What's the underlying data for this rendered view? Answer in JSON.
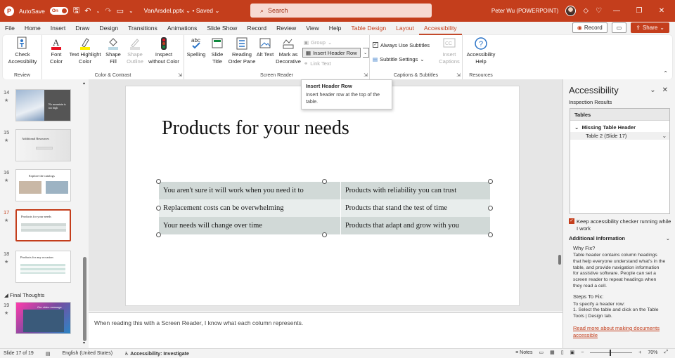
{
  "titlebar": {
    "autosave_label": "AutoSave",
    "autosave_state": "On",
    "doc_name": "VanArsdel.pptx",
    "doc_status": "• Saved",
    "search_placeholder": "Search",
    "user": "Peter Wu (POWERPOINT)"
  },
  "menu": {
    "items": [
      "File",
      "Home",
      "Insert",
      "Draw",
      "Design",
      "Transitions",
      "Animations",
      "Slide Show",
      "Record",
      "Review",
      "View",
      "Help",
      "Table Design",
      "Layout",
      "Accessibility"
    ],
    "record_btn": "Record",
    "share_btn": "Share"
  },
  "ribbon": {
    "review_group": {
      "label": "Review",
      "check_btn": "Check Accessibility"
    },
    "color_group": {
      "label": "Color & Contrast",
      "font_color": "Font Color",
      "text_highlight": "Text Highlight Color",
      "shape_fill": "Shape Fill",
      "shape_outline": "Shape Outline",
      "inspect": "Inspect without Color"
    },
    "screen_reader_group": {
      "label": "Screen Reader",
      "spelling": "Spelling",
      "slide_title": "Slide Title",
      "reading_order": "Reading Order Pane",
      "alt_text": "Alt Text",
      "mark_decorative": "Mark as Decorative",
      "group": "Group",
      "insert_header_row": "Insert Header Row",
      "link_text": "Link Text"
    },
    "captions_group": {
      "label": "Captions & Subtitles",
      "always_use": "Always Use Subtitles",
      "subtitle_settings": "Subtitle Settings",
      "insert_captions": "Insert Captions"
    },
    "resources_group": {
      "label": "Resources",
      "help": "Accessibility Help"
    }
  },
  "tooltip": {
    "title": "Insert Header Row",
    "desc": "Insert header row at the top of the table."
  },
  "thumbnails": [
    {
      "num": "14",
      "title": "",
      "subtitle": "No mountain is too high"
    },
    {
      "num": "15",
      "title": "Additional Resources",
      "subtitle": ""
    },
    {
      "num": "16",
      "title": "Explore the catalogs",
      "subtitle": ""
    },
    {
      "num": "17",
      "title": "Products for your needs",
      "subtitle": ""
    },
    {
      "num": "18",
      "title": "Products for any occasion",
      "subtitle": ""
    },
    {
      "num": "19",
      "title": "Our video message",
      "subtitle": ""
    }
  ],
  "section_label": "Final Thoughts",
  "slide": {
    "title": "Products for your needs",
    "rows": [
      [
        "You aren't sure it will work when you need it to",
        "Products with reliability you can trust"
      ],
      [
        "Replacement costs can be overwhelming",
        "Products that stand the test of time"
      ],
      [
        "Your needs will change over time",
        "Products that adapt and grow with you"
      ]
    ]
  },
  "notes": "When reading this with a Screen Reader, I know what each column represents.",
  "pane": {
    "title": "Accessibility",
    "inspection": "Inspection Results",
    "tables_hdr": "Tables",
    "issue": "Missing Table Header",
    "item": "Table 2  (Slide 17)",
    "keep_running": "Keep accessibility checker running while I work",
    "additional": "Additional Information",
    "why_fix": "Why Fix?",
    "why_body": "Table header contains column headings that help everyone understand what's in the table, and provide navigation information for assistive software. People can set a screen reader to repeat headings when they read a cell.",
    "steps": "Steps To Fix:",
    "steps_body1": "To specify a header row:",
    "steps_body2": "1. Select the table and click on the Table Tools | Design tab.",
    "link": "Read more about making documents accessible"
  },
  "status": {
    "slide": "Slide 17 of 19",
    "lang": "English (United States)",
    "acc": "Accessibility: Investigate",
    "notes": "Notes",
    "zoom": "70%"
  },
  "colors": {
    "accent": "#c43e1c",
    "table_dark": "#d1d9d7",
    "table_light": "#e8edec"
  }
}
